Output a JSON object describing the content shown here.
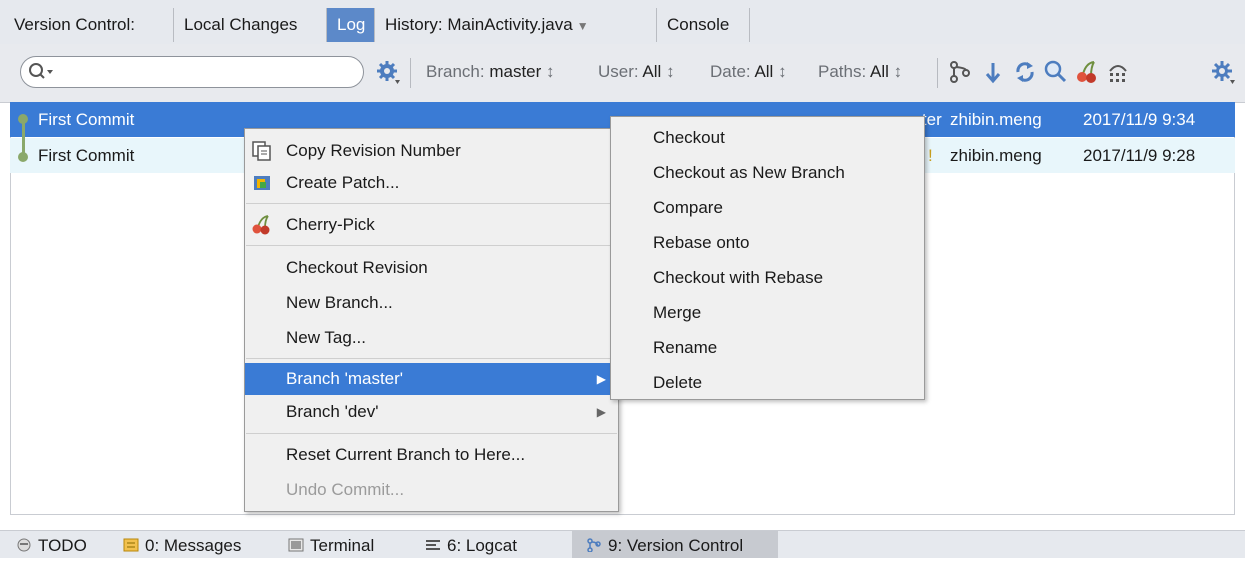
{
  "tabs": {
    "label": "Version Control:",
    "local_changes": "Local Changes",
    "log": "Log",
    "history": "History: MainActivity.java",
    "console": "Console"
  },
  "toolbar": {
    "search_placeholder": "",
    "branch_label": "Branch:",
    "branch_value": "master",
    "user_label": "User:",
    "user_value": "All",
    "date_label": "Date:",
    "date_value": "All",
    "paths_label": "Paths:",
    "paths_value": "All",
    "sort_arrows": "↕"
  },
  "commits": [
    {
      "message": "First Commit",
      "branch": "master",
      "author": "zhibin.meng",
      "date": "2017/11/9 9:34",
      "selected": true
    },
    {
      "message": "First Commit",
      "branch": "",
      "author": "zhibin.meng",
      "date": "2017/11/9 9:28",
      "selected": false
    }
  ],
  "context_menu": {
    "items": [
      {
        "label": "Copy Revision Number",
        "icon": "copy-icon"
      },
      {
        "label": "Create Patch...",
        "icon": "patch-icon"
      },
      {
        "label": "Cherry-Pick",
        "icon": "cherry-icon"
      },
      {
        "label": "Checkout Revision"
      },
      {
        "label": "New Branch..."
      },
      {
        "label": "New Tag..."
      },
      {
        "label": "Branch 'master'",
        "highlighted": true
      },
      {
        "label": "Branch 'dev'"
      },
      {
        "label": "Reset Current Branch to Here..."
      },
      {
        "label": "Undo Commit...",
        "disabled": true
      }
    ]
  },
  "submenu": {
    "items": [
      "Checkout",
      "Checkout as New Branch",
      "Compare",
      "Rebase onto",
      "Checkout with Rebase",
      "Merge",
      "Rename",
      "Delete"
    ]
  },
  "statusbar": {
    "todo": "TODO",
    "messages": "0: Messages",
    "terminal": "Terminal",
    "logcat": "6: Logcat",
    "version_control": "9: Version Control"
  },
  "colors": {
    "selection": "#3a7bd5",
    "graph": "#8aa86a",
    "highlight_row": "#e8f6fb"
  }
}
